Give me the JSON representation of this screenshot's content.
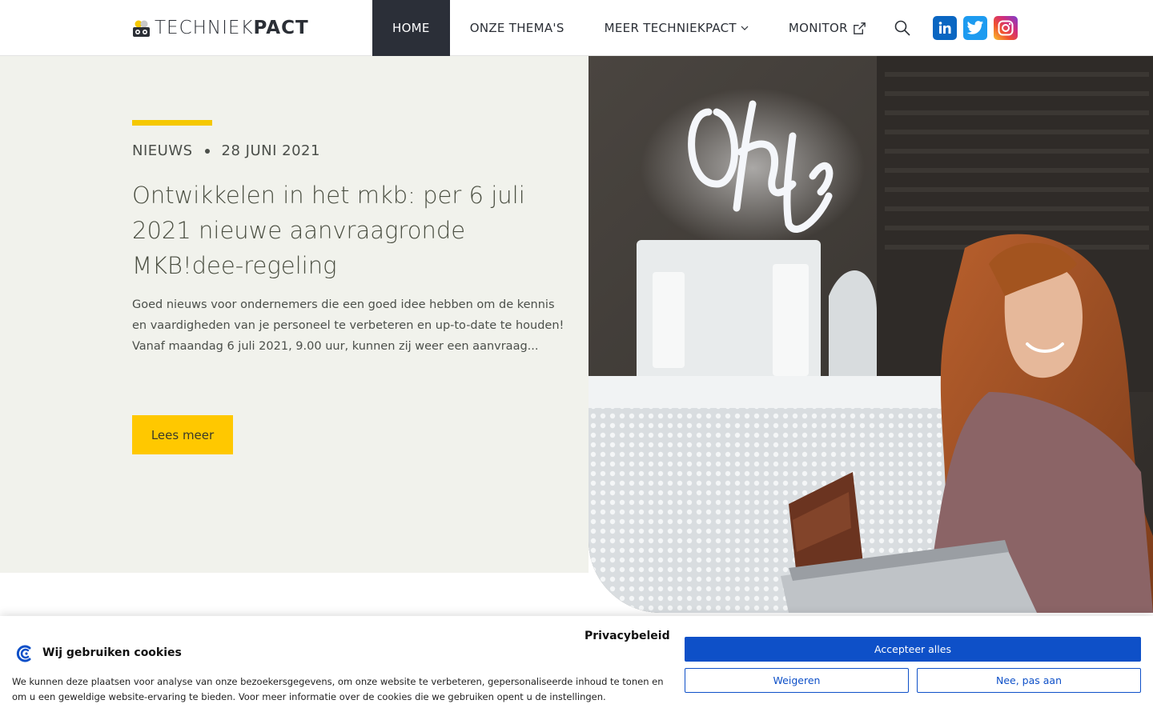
{
  "header": {
    "logo": {
      "text_light": "TECHNIEK",
      "text_bold": "PACT"
    },
    "nav": [
      {
        "label": "HOME",
        "active": true
      },
      {
        "label": "ONZE THEMA'S",
        "active": false
      },
      {
        "label": "MEER TECHNIEKPACT",
        "active": false,
        "icon": "chevron-down-icon"
      },
      {
        "label": "MONITOR",
        "active": false,
        "icon": "external-link-icon"
      }
    ],
    "search_icon": "search-icon",
    "social": [
      {
        "name": "linkedin-icon",
        "color": "#0a66c2"
      },
      {
        "name": "twitter-icon",
        "color": "#1d9bf0"
      },
      {
        "name": "instagram-icon",
        "color": "#d12d7a"
      }
    ]
  },
  "hero": {
    "category": "NIEUWS",
    "date": "28 JUNI 2021",
    "title": "Ontwikkelen in het mkb: per 6 juli 2021 nieuwe aanvraagronde MKB!dee-regeling",
    "excerpt": "Goed nieuws voor ondernemers die een goed idee hebben om de kennis en vaardigheden van je personeel te verbeteren en up-to-date te houden! Vanaf maandag 6 juli 2021, 9.00 uur, kunnen zij weer een aanvraag...",
    "button": "Lees meer",
    "neon_sign": "Oh hello",
    "accent_color": "#ffc800",
    "background_color": "#f1f2ec"
  },
  "cookie_banner": {
    "title": "Wij gebruiken cookies",
    "policy_link": "Privacybeleid",
    "text": "We kunnen deze plaatsen voor analyse van onze bezoekersgegevens, om onze website te verbeteren, gepersonaliseerde inhoud te tonen en om u een geweldige website-ervaring te bieden. Voor meer informatie over de cookies die we gebruiken opent u de instellingen.",
    "accept": "Accepteer alles",
    "deny": "Weigeren",
    "customize": "Nee, pas aan",
    "accent_color": "#0e50c8"
  }
}
